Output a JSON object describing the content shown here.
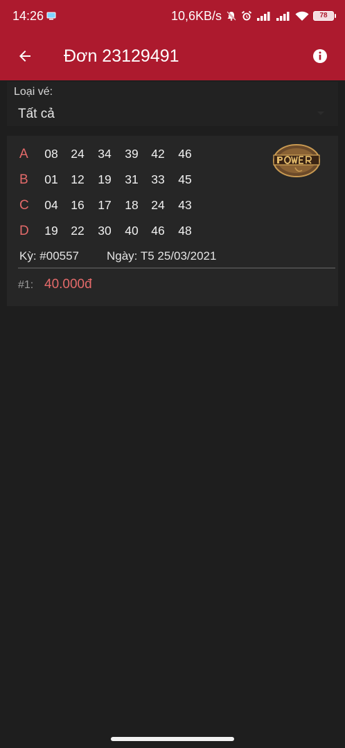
{
  "status_bar": {
    "time": "14:26",
    "net_speed": "10,6KB/s",
    "battery": "78"
  },
  "app_bar": {
    "title": "Đơn 23129491",
    "back_icon": "arrow-left-icon",
    "info_icon": "info-icon"
  },
  "filter": {
    "label": "Loại vé:",
    "value": "Tất cả"
  },
  "ticket": {
    "logo": "power-655-logo",
    "lines": [
      {
        "label": "A",
        "numbers": [
          "08",
          "24",
          "34",
          "39",
          "42",
          "46"
        ]
      },
      {
        "label": "B",
        "numbers": [
          "01",
          "12",
          "19",
          "31",
          "33",
          "45"
        ]
      },
      {
        "label": "C",
        "numbers": [
          "04",
          "16",
          "17",
          "18",
          "24",
          "43"
        ]
      },
      {
        "label": "D",
        "numbers": [
          "19",
          "22",
          "30",
          "40",
          "46",
          "48"
        ]
      }
    ],
    "draw": "Kỳ: #00557",
    "date": "Ngày: T5  25/03/2021",
    "price_index": "#1:",
    "price": "40.000đ"
  },
  "colors": {
    "header": "#ad1a2e",
    "background": "#1e1e1e",
    "accent_red": "#e46a6a"
  }
}
